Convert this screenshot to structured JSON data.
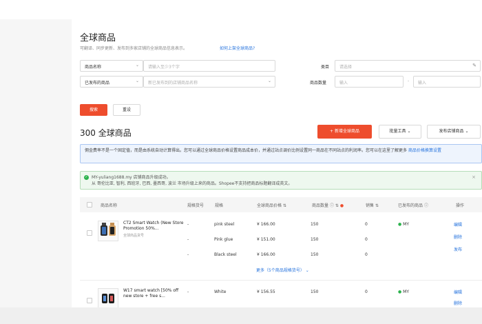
{
  "header": {
    "title": "全球商品",
    "subtitle": "可翻译、同步更新、发布到多家店铺的全球商品信息表示。",
    "help_link": "如何上架全球商品?"
  },
  "filters": {
    "name_select": "商品名称",
    "name_placeholder": "请输入至少3个字",
    "category_label": "类目",
    "category_placeholder": "请选择",
    "published_select": "已发布的商品",
    "shop_placeholder": "新已发布到的店铺商品名称",
    "stock_label": "商品数量",
    "stock_min_placeholder": "输入",
    "stock_max_placeholder": "输入",
    "range_sep": "-",
    "search_button": "搜索",
    "reset_button": "重设"
  },
  "toolbar": {
    "count_text": "300 全球商品",
    "add_button": "新增全球商品",
    "batch_tools": "批量工具",
    "publish_shop": "发布店铺商品"
  },
  "notices": {
    "info_text": "佣金费率不是一个固定值，而是由系统自动计算得出。您可以通过全球商品价格设置商品成本价，并通过站点调价比例设置同一商品在不同站点的利润率。您可以在这里了解更多",
    "info_link": "商品价格换算设置",
    "success_line1": "MY-yuliang1688.my 店铺商品升级成功。",
    "success_line2": "从 哥伦比亚, 智利, 西班牙, 巴西, 墨西哥, 波兰 市场升级上来的商品。Shopee不支持把商品标题翻译成英文。"
  },
  "table": {
    "columns": [
      "商品名称",
      "规格货号",
      "规格",
      "全球商品价格",
      "商品数量",
      "销售",
      "已发布的商品",
      "操作"
    ],
    "products": [
      {
        "name": "CT2 Smart Watch (New Store Promotion 50%...",
        "sku": "全球商品货号",
        "variants": [
          {
            "sku": "-",
            "variant": "pink steel",
            "price": "¥ 166.00",
            "stock": "150",
            "sales": "0"
          },
          {
            "sku": "-",
            "variant": "Pink glue",
            "price": "¥ 151.00",
            "stock": "150",
            "sales": "0"
          },
          {
            "sku": "-",
            "variant": "Black steel",
            "price": "¥ 166.00",
            "stock": "150",
            "sales": "0"
          }
        ],
        "published": "MY",
        "more": "更多（5个商品规格货号）",
        "actions": [
          "编辑",
          "删除",
          "发布"
        ]
      },
      {
        "name": "W17 smart watch [50% off new store + free s...",
        "sku": "",
        "variants": [
          {
            "sku": "-",
            "variant": "White",
            "price": "¥ 156.55",
            "stock": "150",
            "sales": "0"
          }
        ],
        "published": "MY",
        "actions": [
          "编辑",
          "删除"
        ]
      }
    ]
  },
  "colors": {
    "accent": "#ee4d2d",
    "link": "#2673dd",
    "success": "#2bb24c"
  },
  "icons": {
    "chevron": "chevron-down-icon",
    "pen": "pen-icon",
    "help": "help-icon",
    "sort": "sort-icon",
    "status": "status-dot-icon"
  }
}
